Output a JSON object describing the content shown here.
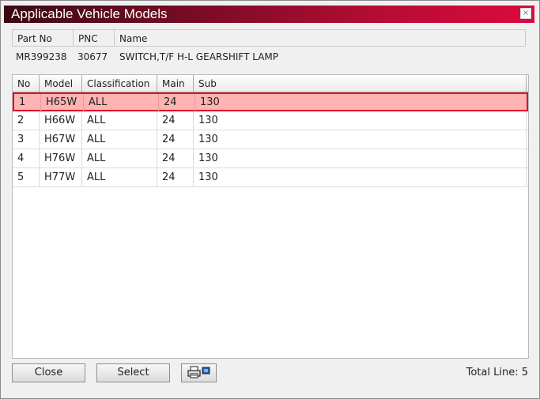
{
  "window": {
    "title": "Applicable Vehicle Models",
    "close_glyph": "×",
    "accent_color": "#dc0a3c"
  },
  "part_info": {
    "headers": [
      "Part No",
      "PNC",
      "Name"
    ],
    "values": {
      "part_no": "MR399238",
      "pnc": "30677",
      "name": "SWITCH,T/F H-L GEARSHIFT LAMP"
    }
  },
  "grid": {
    "headers": [
      "No",
      "Model",
      "Classification",
      "Main",
      "Sub"
    ],
    "rows": [
      [
        "1",
        "H65W",
        "ALL",
        "24",
        "130"
      ],
      [
        "2",
        "H66W",
        "ALL",
        "24",
        "130"
      ],
      [
        "3",
        "H67W",
        "ALL",
        "24",
        "130"
      ],
      [
        "4",
        "H76W",
        "ALL",
        "24",
        "130"
      ],
      [
        "5",
        "H77W",
        "ALL",
        "24",
        "130"
      ]
    ],
    "selected_row": 0,
    "selected_color": "#ffb3b3"
  },
  "footer": {
    "close_label": "Close",
    "select_label": "Select",
    "print_icon": "printer-icon",
    "total_label": "Total Line: 5"
  }
}
